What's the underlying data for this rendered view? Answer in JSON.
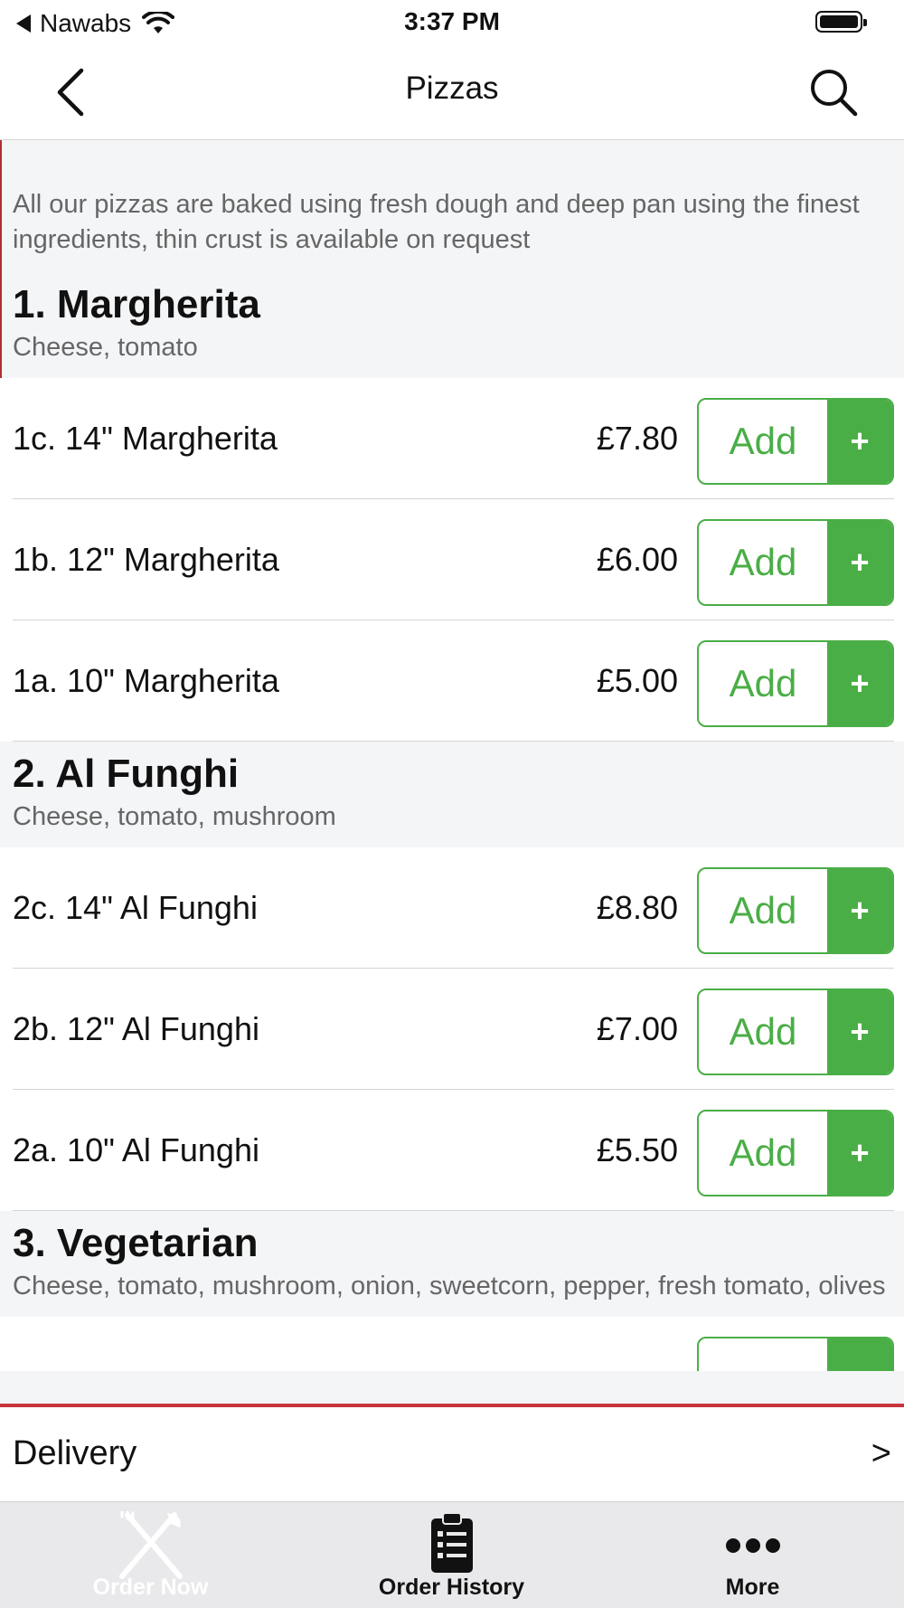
{
  "status_bar": {
    "back_app": "Nawabs",
    "time": "3:37 PM"
  },
  "nav": {
    "title": "Pizzas",
    "back_icon": "chevron-left-icon",
    "search_icon": "search-icon"
  },
  "intro_text": "All our pizzas are baked using fresh dough and deep pan using the finest ingredients, thin crust is available on request",
  "add_label": "Add",
  "add_plus": "+",
  "categories": [
    {
      "title": "1. Margherita",
      "description": "Cheese, tomato",
      "items": [
        {
          "name": "1c. 14\" Margherita",
          "price": "£7.80"
        },
        {
          "name": "1b. 12\" Margherita",
          "price": "£6.00"
        },
        {
          "name": "1a. 10\" Margherita",
          "price": "£5.00"
        }
      ]
    },
    {
      "title": "2. Al Funghi",
      "description": "Cheese, tomato, mushroom",
      "items": [
        {
          "name": "2c. 14\" Al Funghi",
          "price": "£8.80"
        },
        {
          "name": "2b. 12\" Al Funghi",
          "price": "£7.00"
        },
        {
          "name": "2a. 10\" Al Funghi",
          "price": "£5.50"
        }
      ]
    },
    {
      "title": "3. Vegetarian",
      "description": "Cheese, tomato, mushroom, onion, sweetcorn, pepper, fresh tomato, olives"
    }
  ],
  "delivery": {
    "label": "Delivery",
    "arrow": ">"
  },
  "tabs": [
    {
      "label": "Order Now",
      "icon": "fork-knife-icon",
      "active": true
    },
    {
      "label": "Order History",
      "icon": "clipboard-list-icon",
      "active": false
    },
    {
      "label": "More",
      "icon": "more-dots-icon",
      "active": false
    }
  ],
  "colors": {
    "accent_green": "#4aae46",
    "delivery_border_red": "#c8353d",
    "background_gray": "#f4f5f7"
  }
}
